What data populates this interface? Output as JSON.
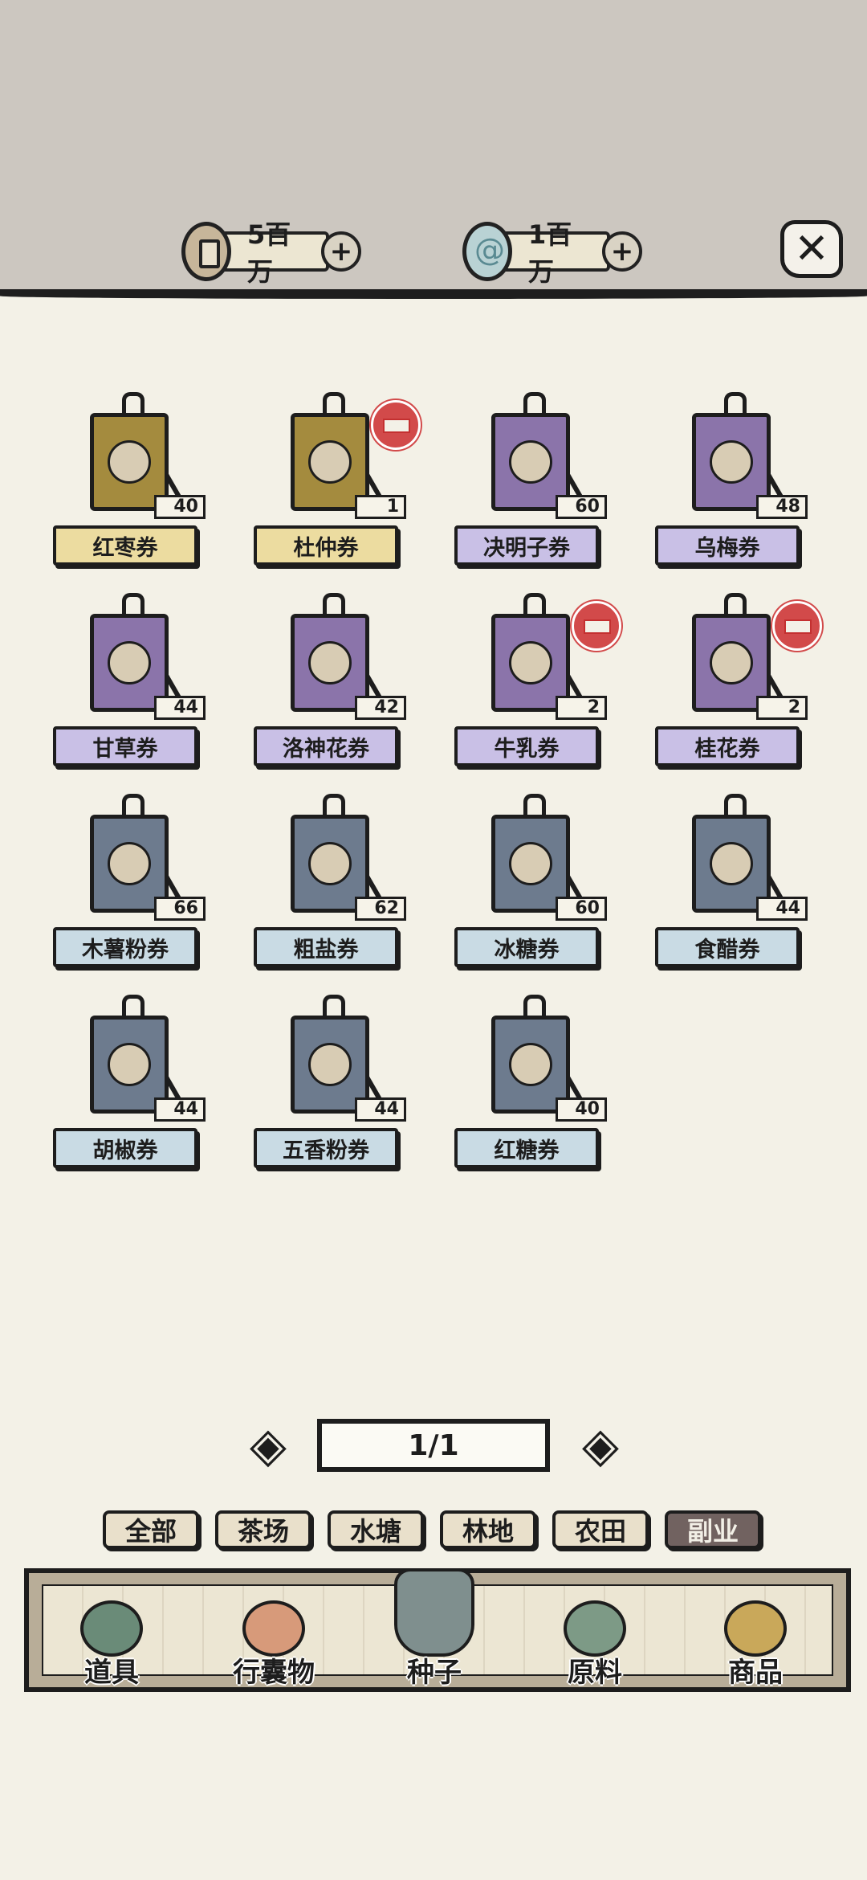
{
  "currency": {
    "coins": "5百万",
    "jade": "1百万"
  },
  "items": [
    {
      "name": "红枣券",
      "count": "40",
      "theme": "gold",
      "new": false
    },
    {
      "name": "杜仲券",
      "count": "1",
      "theme": "gold",
      "new": true
    },
    {
      "name": "决明子券",
      "count": "60",
      "theme": "purple",
      "new": false
    },
    {
      "name": "乌梅券",
      "count": "48",
      "theme": "purple",
      "new": false
    },
    {
      "name": "甘草券",
      "count": "44",
      "theme": "purple",
      "new": false
    },
    {
      "name": "洛神花券",
      "count": "42",
      "theme": "purple",
      "new": false
    },
    {
      "name": "牛乳券",
      "count": "2",
      "theme": "purple",
      "new": true
    },
    {
      "name": "桂花券",
      "count": "2",
      "theme": "purple",
      "new": true
    },
    {
      "name": "木薯粉券",
      "count": "66",
      "theme": "slate",
      "new": false
    },
    {
      "name": "粗盐券",
      "count": "62",
      "theme": "slate",
      "new": false
    },
    {
      "name": "冰糖券",
      "count": "60",
      "theme": "slate",
      "new": false
    },
    {
      "name": "食醋券",
      "count": "44",
      "theme": "slate",
      "new": false
    },
    {
      "name": "胡椒券",
      "count": "44",
      "theme": "slate",
      "new": false
    },
    {
      "name": "五香粉券",
      "count": "44",
      "theme": "slate",
      "new": false
    },
    {
      "name": "红糖券",
      "count": "40",
      "theme": "slate",
      "new": false
    }
  ],
  "pager": {
    "text": "1/1"
  },
  "filters": [
    {
      "label": "全部",
      "active": false
    },
    {
      "label": "茶场",
      "active": false
    },
    {
      "label": "水塘",
      "active": false
    },
    {
      "label": "林地",
      "active": false
    },
    {
      "label": "农田",
      "active": false
    },
    {
      "label": "副业",
      "active": true
    }
  ],
  "nav": [
    {
      "label": "道具",
      "icon": "tools-icon",
      "active": false
    },
    {
      "label": "行囊物",
      "icon": "robe-icon",
      "active": false
    },
    {
      "label": "种子",
      "icon": "seed-bag-icon",
      "active": true
    },
    {
      "label": "原料",
      "icon": "leaf-icon",
      "active": false
    },
    {
      "label": "商品",
      "icon": "goods-icon",
      "active": false
    }
  ],
  "colors": {
    "gold": "#a48b3e",
    "purple": "#8b74aa",
    "slate": "#6d7b8e",
    "active_filter": "#716260",
    "new_stamp": "#d24a4a"
  }
}
